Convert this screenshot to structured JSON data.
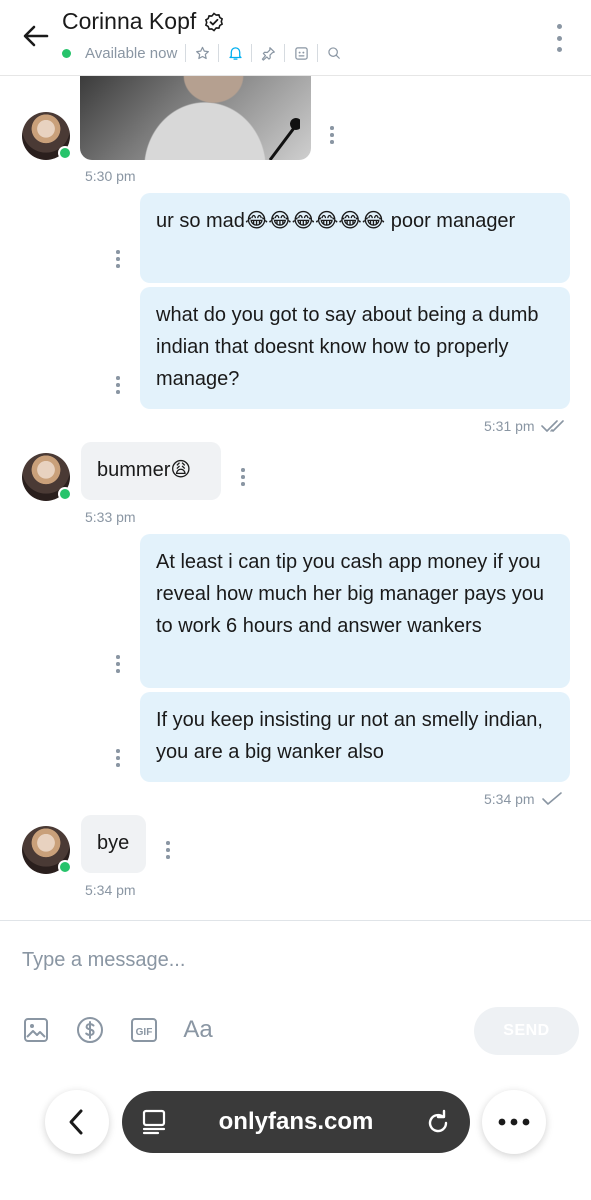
{
  "header": {
    "contact_name": "Corinna Kopf",
    "status": "Available now"
  },
  "messages": [
    {
      "id": "m0",
      "from": "them",
      "type": "image",
      "time": "5:30 pm"
    },
    {
      "id": "m1",
      "from": "me",
      "text": "ur so mad😂😂😂😂😂😂 poor manager"
    },
    {
      "id": "m2",
      "from": "me",
      "text": "what do you got to say about being a dumb indian that doesnt know how to properly manage?",
      "time": "5:31 pm",
      "read": true
    },
    {
      "id": "m3",
      "from": "them",
      "text": "bummer😩",
      "time": "5:33 pm"
    },
    {
      "id": "m4",
      "from": "me",
      "text": "At least i can tip you cash app money if you reveal how much her big manager pays you to work 6 hours and answer wankers"
    },
    {
      "id": "m5",
      "from": "me",
      "text": "If you keep insisting ur not an smelly indian, you are a big wanker also",
      "time": "5:34 pm",
      "read": false
    },
    {
      "id": "m6",
      "from": "them",
      "text": "bye",
      "time": "5:34 pm"
    }
  ],
  "composer": {
    "placeholder": "Type a message...",
    "send_label": "SEND",
    "font_tool_label": "Aa",
    "tools": [
      "image-icon",
      "dollar-icon",
      "gif-icon",
      "text-format-icon"
    ]
  },
  "browser": {
    "url": "onlyfans.com"
  },
  "colors": {
    "accent": "#00aff0",
    "online": "#27c36b",
    "my_bubble": "#e3f2fb",
    "their_bubble": "#f0f2f4",
    "muted_text": "#8a96a3"
  }
}
